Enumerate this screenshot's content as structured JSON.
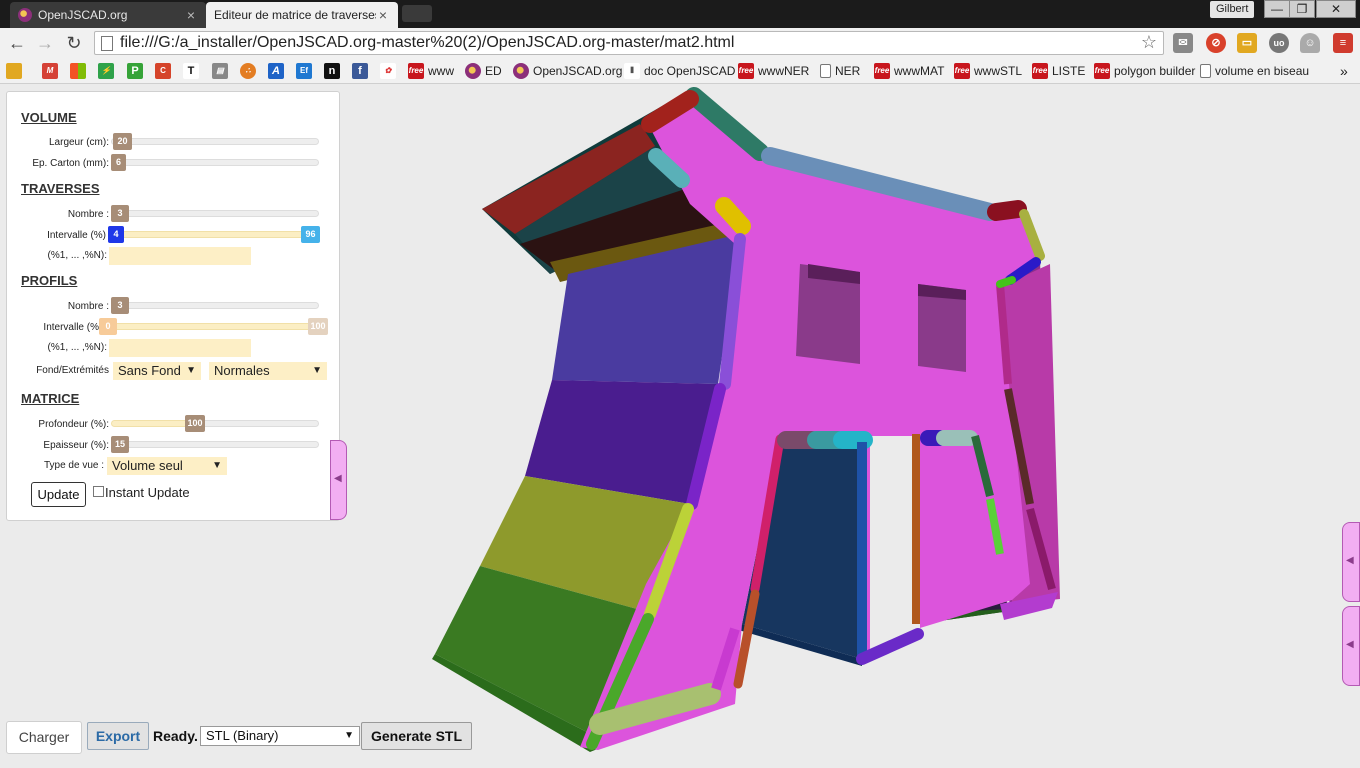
{
  "browser": {
    "tabs": [
      {
        "title": "OpenJSCAD.org",
        "active": false
      },
      {
        "title": "Editeur de matrice de traverses",
        "active": true
      }
    ],
    "user": "Gilbert",
    "window_controls": {
      "min": "—",
      "max": "❐",
      "close": "✕"
    },
    "url": "file:///G:/a_installer/OpenJSCAD.org-master%20(2)/OpenJSCAD.org-master/mat2.html",
    "extensions": [
      "mail-icon",
      "stop-icon",
      "folder-icon",
      "ublock-icon",
      "ghost-icon",
      "menu-icon"
    ],
    "bookmarks_icons": [
      "folder-icon",
      "gmail-icon",
      "windows-icon",
      "tool-icon",
      "p-icon",
      "doc-icon",
      "t-icon",
      "mail-icon",
      "dots-icon",
      "a-icon",
      "ef-icon",
      "n-icon",
      "facebook-icon",
      "flower-icon"
    ],
    "bookmarks": [
      {
        "label": "www",
        "icon": "free"
      },
      {
        "label": "ED",
        "icon": "jscad"
      },
      {
        "label": "OpenJSCAD.org",
        "icon": "jscad"
      },
      {
        "label": "doc OpenJSCAD",
        "icon": "book"
      },
      {
        "label": "wwwNER",
        "icon": "free"
      },
      {
        "label": "NER",
        "icon": "page"
      },
      {
        "label": "wwwMAT",
        "icon": "free"
      },
      {
        "label": "wwwSTL",
        "icon": "free"
      },
      {
        "label": "LISTE",
        "icon": "free"
      },
      {
        "label": "polygon builder",
        "icon": "free"
      },
      {
        "label": "volume en biseau",
        "icon": "page"
      }
    ],
    "bookmarks_more": "»",
    "free_badge": "free"
  },
  "panel": {
    "volume": {
      "title": "VOLUME",
      "largeur_label": "Largeur (cm):",
      "largeur_value": "20",
      "carton_label": "Ep. Carton (mm):",
      "carton_value": "6"
    },
    "traverses": {
      "title": "TRAVERSES",
      "nombre_label": "Nombre :",
      "nombre_value": "3",
      "intervalle_label": "Intervalle (%)",
      "intervalle_min": "4",
      "intervalle_max": "96",
      "list_label": "(%1, ... ,%N):"
    },
    "profils": {
      "title": "PROFILS",
      "nombre_label": "Nombre :",
      "nombre_value": "3",
      "intervalle_label": "Intervalle (%",
      "intervalle_min": "0",
      "intervalle_max": "100",
      "list_label": "(%1, ... ,%N):",
      "fond_label": "Fond/Extrémités",
      "fond_value": "Sans Fond",
      "extremites_value": "Normales"
    },
    "matrice": {
      "title": "MATRICE",
      "profondeur_label": "Profondeur (%):",
      "profondeur_value": "100",
      "epaisseur_label": "Epaisseur (%):",
      "epaisseur_value": "15",
      "vue_label": "Type de vue :",
      "vue_value": "Volume seul"
    },
    "update_label": "Update",
    "instant_update_label": "Instant Update",
    "collapse_arrow": "◀"
  },
  "bottom": {
    "charger_label": "Charger",
    "export_label": "Export",
    "status": "Ready.",
    "format": "STL (Binary)",
    "generate_label": "Generate STL"
  },
  "colors": {
    "model_main": "#dc54dc",
    "accent_blue": "#2b6aa6",
    "slider_thumb": "#a78d77"
  }
}
